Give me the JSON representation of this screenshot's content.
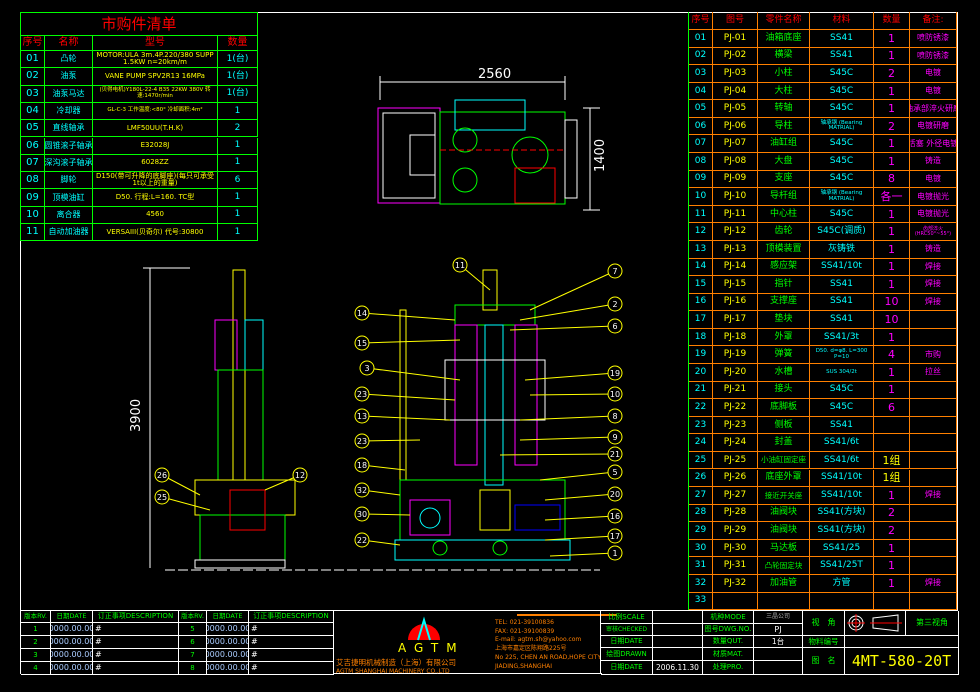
{
  "colors": {
    "header": "#ff0000",
    "number": "#00ffff",
    "code": "#ffff00",
    "name": "#00ff00",
    "qty": "#ff00ff",
    "note": "#ff00ff",
    "grid_left": "#00ff00",
    "grid_right": "#ff8000"
  },
  "left_table": {
    "title": "市购件清单",
    "headers": [
      "序号",
      "名称",
      "型号",
      "数量"
    ],
    "rows": [
      {
        "no": "01",
        "name": "凸轮",
        "model": "MOTOR:ULA 3m.4P.220/380  SUPP 1.5KW n=20km/m",
        "qty": "1(台)"
      },
      {
        "no": "02",
        "name": "油泵",
        "model": "VANE PUMP  SPV2R13  16MPa",
        "qty": "1(台)"
      },
      {
        "no": "03",
        "name": "油泵马达",
        "model": "(贝得电机)Y180L-22-4 B35 22KW 380V 转速:1470r/min",
        "qty": "1(台)"
      },
      {
        "no": "04",
        "name": "冷却器",
        "model": "GL-C-3 工作温度:<80° 冷却面积:4m²",
        "qty": "1"
      },
      {
        "no": "05",
        "name": "直线轴承",
        "model": "LMF50UU(T.H.K)",
        "qty": "2"
      },
      {
        "no": "06",
        "name": "圆锥滚子轴承",
        "model": "E32028J",
        "qty": "1"
      },
      {
        "no": "07",
        "name": "深沟滚子轴承",
        "model": "6028ZZ",
        "qty": "1"
      },
      {
        "no": "08",
        "name": "脚轮",
        "model": "D150(带可升降的底脚座)(每只可承受1t以上的重量)",
        "qty": "6"
      },
      {
        "no": "09",
        "name": "顶模油缸",
        "model": "D50. 行程:L=160. TC型",
        "qty": "1"
      },
      {
        "no": "10",
        "name": "离合器",
        "model": "4560",
        "qty": "1"
      },
      {
        "no": "11",
        "name": "自动加油器",
        "model": "VERSAIII(贝奇尔) 代号:30800",
        "qty": "1"
      }
    ]
  },
  "right_table": {
    "headers": [
      "序号",
      "图号",
      "零件名称",
      "材料",
      "数量",
      "备注:"
    ],
    "rows": [
      {
        "no": "01",
        "dwg": "PJ-01",
        "name": "油箱底座",
        "mat": "SS41",
        "qty": "1",
        "note": "喷防锈漆"
      },
      {
        "no": "02",
        "dwg": "PJ-02",
        "name": "横梁",
        "mat": "SS41",
        "qty": "1",
        "note": "喷防锈漆"
      },
      {
        "no": "03",
        "dwg": "PJ-03",
        "name": "小柱",
        "mat": "S45C",
        "qty": "2",
        "note": "电镀"
      },
      {
        "no": "04",
        "dwg": "PJ-04",
        "name": "大柱",
        "mat": "S45C",
        "qty": "1",
        "note": "电镀"
      },
      {
        "no": "05",
        "dwg": "PJ-05",
        "name": "转轴",
        "mat": "S45C",
        "qty": "1",
        "note": "轴承部淬火研磨"
      },
      {
        "no": "06",
        "dwg": "PJ-06",
        "name": "导柱",
        "mat": "轴承钢 (Bearing MATRIAL)",
        "qty": "2",
        "note": "电镀研磨"
      },
      {
        "no": "07",
        "dwg": "PJ-07",
        "name": "油缸组",
        "mat": "S45C",
        "qty": "1",
        "note": "活塞 外径电镀"
      },
      {
        "no": "08",
        "dwg": "PJ-08",
        "name": "大盘",
        "mat": "S45C",
        "qty": "1",
        "note": "铸造"
      },
      {
        "no": "09",
        "dwg": "PJ-09",
        "name": "支座",
        "mat": "S45C",
        "qty": "8",
        "note": "电镀"
      },
      {
        "no": "10",
        "dwg": "PJ-10",
        "name": "导杆组",
        "mat": "轴承钢 (Bearing MATRIAL)",
        "qty": "各一",
        "note": "电镀抛光"
      },
      {
        "no": "11",
        "dwg": "PJ-11",
        "name": "中心柱",
        "mat": "S45C",
        "qty": "1",
        "note": "电镀抛光"
      },
      {
        "no": "12",
        "dwg": "PJ-12",
        "name": "齿轮",
        "mat": "S45C(调质)",
        "qty": "1",
        "note": "齿部淬火(HRC50°~55°)"
      },
      {
        "no": "13",
        "dwg": "PJ-13",
        "name": "顶模装置",
        "mat": "灰铸铁",
        "qty": "1",
        "note": "铸造"
      },
      {
        "no": "14",
        "dwg": "PJ-14",
        "name": "感应架",
        "mat": "SS41/10t",
        "qty": "1",
        "note": "焊接"
      },
      {
        "no": "15",
        "dwg": "PJ-15",
        "name": "指针",
        "mat": "SS41",
        "qty": "1",
        "note": "焊接"
      },
      {
        "no": "16",
        "dwg": "PJ-16",
        "name": "支撑座",
        "mat": "SS41",
        "qty": "10",
        "note": "焊接"
      },
      {
        "no": "17",
        "dwg": "PJ-17",
        "name": "垫块",
        "mat": "SS41",
        "qty": "10",
        "note": ""
      },
      {
        "no": "18",
        "dwg": "PJ-18",
        "name": "外罩",
        "mat": "SS41/3t",
        "qty": "1",
        "note": ""
      },
      {
        "no": "19",
        "dwg": "PJ-19",
        "name": "弹簧",
        "mat": "D50. d=φ8. L=300 P=10",
        "qty": "4",
        "note": "市购"
      },
      {
        "no": "20",
        "dwg": "PJ-20",
        "name": "水槽",
        "mat": "SUS 304/2t",
        "qty": "1",
        "note": "拉丝"
      },
      {
        "no": "21",
        "dwg": "PJ-21",
        "name": "接头",
        "mat": "S45C",
        "qty": "1",
        "note": ""
      },
      {
        "no": "22",
        "dwg": "PJ-22",
        "name": "底脚板",
        "mat": "S45C",
        "qty": "6",
        "note": ""
      },
      {
        "no": "23",
        "dwg": "PJ-23",
        "name": "侧板",
        "mat": "SS41",
        "qty": "",
        "note": ""
      },
      {
        "no": "24",
        "dwg": "PJ-24",
        "name": "封盖",
        "mat": "SS41/6t",
        "qty": "",
        "note": ""
      },
      {
        "no": "25",
        "dwg": "PJ-25",
        "name": "小油缸固定座",
        "mat": "SS41/6t",
        "qty": "1组",
        "note": ""
      },
      {
        "no": "26",
        "dwg": "PJ-26",
        "name": "底座外罩",
        "mat": "SS41/10t",
        "qty": "1组",
        "note": ""
      },
      {
        "no": "27",
        "dwg": "PJ-27",
        "name": "接近开关座",
        "mat": "SS41/10t",
        "qty": "1",
        "note": "焊接"
      },
      {
        "no": "28",
        "dwg": "PJ-28",
        "name": "油阀块",
        "mat": "SS41(方块)",
        "qty": "2",
        "note": ""
      },
      {
        "no": "29",
        "dwg": "PJ-29",
        "name": "油阀块",
        "mat": "SS41(方块)",
        "qty": "2",
        "note": ""
      },
      {
        "no": "30",
        "dwg": "PJ-30",
        "name": "马达板",
        "mat": "SS41/25",
        "qty": "1",
        "note": ""
      },
      {
        "no": "31",
        "dwg": "PJ-31",
        "name": "凸轮固定块",
        "mat": "SS41/25T",
        "qty": "1",
        "note": ""
      },
      {
        "no": "32",
        "dwg": "PJ-32",
        "name": "加油管",
        "mat": "方管",
        "qty": "1",
        "note": "焊接"
      },
      {
        "no": "33",
        "dwg": "",
        "name": "",
        "mat": "",
        "qty": "",
        "note": ""
      }
    ]
  },
  "revision": {
    "headers": [
      "版本RV.",
      "日期DATE",
      "订正事项DESCRIPTION",
      "版本RV.",
      "日期DATE",
      "订正事项DESCRIPTION"
    ],
    "rows": [
      [
        "1",
        "0000.00.00",
        "#",
        "5",
        "0000.00.00",
        "#"
      ],
      [
        "2",
        "0000.00.00",
        "#",
        "6",
        "0000.00.00",
        "#"
      ],
      [
        "3",
        "0000.00.00",
        "#",
        "7",
        "0000.00.00",
        "#"
      ],
      [
        "4",
        "0000.00.00",
        "#",
        "8",
        "0000.00.00",
        "#"
      ]
    ]
  },
  "company": {
    "logo": "AGTM",
    "name_cn": "艾吉捷明机械制造（上海）有限公司",
    "name_en": "AGTM SHANGHAI MACHINERY CO.,LTD",
    "tel": "TEL: 021-39100836",
    "fax": "FAX: 021-39100839",
    "email": "E-mail: agtm.sh@yahoo.com",
    "addr_cn": "上海市嘉定区陈翔路225号",
    "addr_en1": "No 225, CHEN AN ROAD,HOPE CITY",
    "addr_en2": "JIADING,SHANGHAI"
  },
  "title_block": {
    "scale_label": "比例SCALE",
    "scale": "",
    "checked_label": "审核CHECKED",
    "checked": "",
    "date_label": "日期DATE",
    "date": "",
    "drawn_label": "绘图DRAWN",
    "drawn": "",
    "date2_label": "日期DATE",
    "date2": "2006.11.30",
    "model_label": "机种MODE",
    "model": "三晶公司",
    "dwg_label": "图号DWG.NO.",
    "dwg": "PJ",
    "qty_label": "数量QUT.",
    "qty": "1台",
    "mat_label": "材质MAT.",
    "mat": "",
    "pro_label": "处理PRO.",
    "pro": "",
    "view_label": "视　角",
    "view": "第三视角",
    "part_label": "物料编号",
    "part": "",
    "name_label": "图　名",
    "drawing_name": "4MT-580-20T"
  },
  "drawing": {
    "dims": {
      "top_width": "2560",
      "top_height": "1400",
      "height": "3900"
    },
    "balloons": [
      "11",
      "7",
      "2",
      "6",
      "14",
      "15",
      "3",
      "19",
      "23",
      "10",
      "13",
      "8",
      "9",
      "23",
      "21",
      "18",
      "5",
      "32",
      "20",
      "16",
      "30",
      "17",
      "22",
      "1",
      "26",
      "12",
      "25"
    ]
  }
}
